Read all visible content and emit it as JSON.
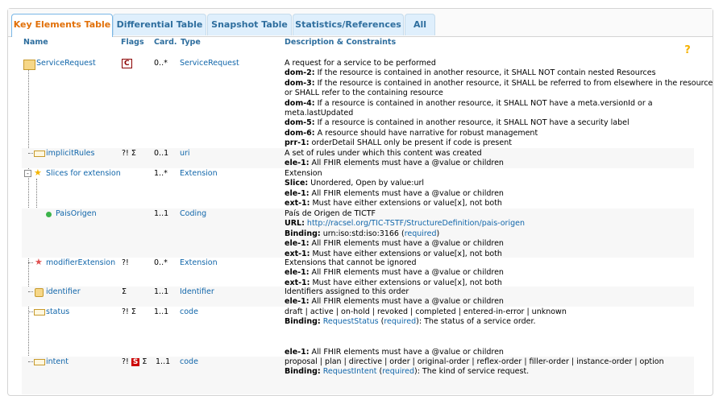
{
  "tabs": [
    {
      "label": "Key Elements Table",
      "active": true
    },
    {
      "label": "Differential Table",
      "active": false
    },
    {
      "label": "Snapshot Table",
      "active": false
    },
    {
      "label": "Statistics/References",
      "active": false
    },
    {
      "label": "All",
      "active": false
    }
  ],
  "headers": {
    "name": "Name",
    "flags": "Flags",
    "card": "Card.",
    "type": "Type",
    "desc": "Description & Constraints",
    "help": "?"
  },
  "rows": {
    "service_request": {
      "name": "ServiceRequest",
      "flag": "C",
      "card": "0..*",
      "type": "ServiceRequest",
      "desc": "A request for a service to be performed",
      "c1_key": "dom-2:",
      "c1_text": " If the resource is contained in another resource, it SHALL NOT contain nested Resources",
      "c2_key": "dom-3:",
      "c2_text": " If the resource is contained in another resource, it SHALL be referred to from elsewhere in the resource",
      "c2_text2": "or SHALL refer to the containing resource",
      "c3_key": "dom-4:",
      "c3_text": " If a resource is contained in another resource, it SHALL NOT have a meta.versionId or a",
      "c3_text2": "meta.lastUpdated",
      "c4_key": "dom-5:",
      "c4_text": " If a resource is contained in another resource, it SHALL NOT have a security label",
      "c5_key": "dom-6:",
      "c5_text": " A resource should have narrative for robust management",
      "c6_key": "prr-1:",
      "c6_text": " orderDetail SHALL only be present if code is present"
    },
    "implicit_rules": {
      "name": "implicitRules",
      "flags": "?! Σ",
      "card": "0..1",
      "type": "uri",
      "desc": "A set of rules under which this content was created",
      "c1_key": "ele-1:",
      "c1_text": " All FHIR elements must have a @value or children"
    },
    "slices_extension": {
      "name": "Slices for extension",
      "card": "1..*",
      "type": "Extension",
      "desc": "Extension",
      "slice_key": "Slice:",
      "slice_text": " Unordered, Open by value:url",
      "c1_key": "ele-1:",
      "c1_text": " All FHIR elements must have a @value or children",
      "c2_key": "ext-1:",
      "c2_text": " Must have either extensions or value[x], not both"
    },
    "pais_origen": {
      "name": "PaisOrigen",
      "card": "1..1",
      "type": "Coding",
      "desc": "País de Origen de TICTF",
      "url_key": "URL:",
      "url_val": "http://racsel.org/TIC-TSTF/StructureDefinition/pais-origen",
      "binding_key": "Binding:",
      "binding_val": " urn:iso:std:iso:3166 (",
      "binding_strength": "required",
      "binding_close": ")",
      "c1_key": "ele-1:",
      "c1_text": " All FHIR elements must have a @value or children",
      "c2_key": "ext-1:",
      "c2_text": " Must have either extensions or value[x], not both"
    },
    "modifier_extension": {
      "name": "modifierExtension",
      "flags": "?!",
      "card": "0..*",
      "type": "Extension",
      "desc": "Extensions that cannot be ignored",
      "c1_key": "ele-1:",
      "c1_text": " All FHIR elements must have a @value or children",
      "c2_key": "ext-1:",
      "c2_text": " Must have either extensions or value[x], not both"
    },
    "identifier": {
      "name": "identifier",
      "flags": "Σ",
      "card": "1..1",
      "type": "Identifier",
      "desc": "Identifiers assigned to this order",
      "c1_key": "ele-1:",
      "c1_text": " All FHIR elements must have a @value or children"
    },
    "status": {
      "name": "status",
      "flags": "?! Σ",
      "card": "1..1",
      "type": "code",
      "desc": "draft | active | on-hold | revoked | completed | entered-in-error | unknown",
      "binding_key": "Binding:",
      "binding_vs": "RequestStatus",
      "binding_open": " (",
      "binding_strength": "required",
      "binding_close": "): The status of a service order.",
      "c1_key": "ele-1:",
      "c1_text": " All FHIR elements must have a @value or children"
    },
    "intent": {
      "name": "intent",
      "flags_a": "?!",
      "flag_s": "S",
      "flags_b": "Σ",
      "card": "1..1",
      "type": "code",
      "desc": "proposal | plan | directive | order | original-order | reflex-order | filler-order | instance-order | option",
      "binding_key": "Binding:",
      "binding_vs": "RequestIntent",
      "binding_open": " (",
      "binding_strength": "required",
      "binding_close": "): The kind of service request."
    }
  },
  "icons": {
    "resource": "resource-icon",
    "element": "element-icon",
    "extension": "extension-star-icon",
    "modifier": "modifier-star-icon",
    "datatype": "datatype-dot-icon",
    "identifier": "datatype-cube-icon",
    "help": "help-icon"
  }
}
